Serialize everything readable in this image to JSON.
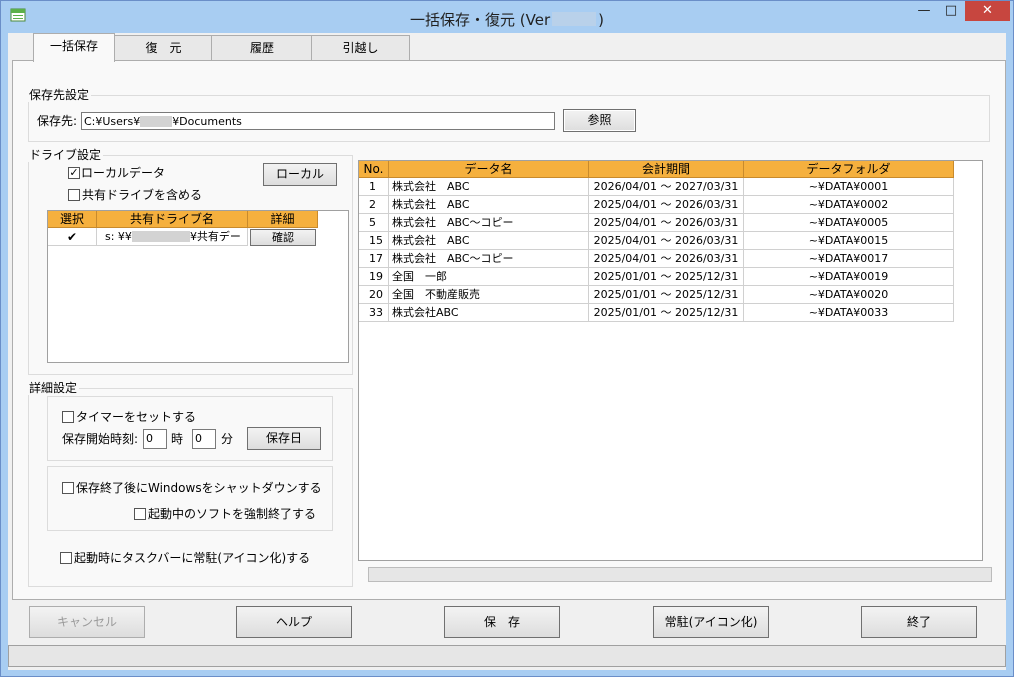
{
  "window": {
    "title_prefix": "一括保存・復元 (Ver",
    "title_suffix": ")",
    "min_glyph": "—",
    "max_glyph": "□",
    "close_glyph": "✕"
  },
  "tabs": [
    {
      "label": "一括保存",
      "active": true
    },
    {
      "label": "復　元"
    },
    {
      "label": "履歴"
    },
    {
      "label": "引越し"
    }
  ],
  "save_dest": {
    "group_title": "保存先設定",
    "label": "保存先:",
    "path_prefix": "C:¥Users¥",
    "path_suffix": "¥Documents",
    "browse_label": "参照"
  },
  "drive": {
    "group_title": "ドライブ設定",
    "local_data_label": "ローカルデータ",
    "local_data_checked": true,
    "include_shared_label": "共有ドライブを含める",
    "include_shared_checked": false,
    "local_button": "ローカル",
    "grid_headers": [
      "選択",
      "共有ドライブ名",
      "詳細"
    ],
    "grid_rows": [
      {
        "selected": true,
        "name_prefix": "s: ¥¥",
        "name_suffix": "¥共有デー",
        "detail": "確認"
      }
    ]
  },
  "detail": {
    "group_title": "詳細設定",
    "timer_label": "タイマーをセットする",
    "timer_checked": false,
    "start_time_label": "保存開始時刻:",
    "hour_value": "0",
    "hour_unit": "時",
    "minute_value": "0",
    "minute_unit": "分",
    "save_day_button": "保存日",
    "shutdown_label": "保存終了後にWindowsをシャットダウンする",
    "force_quit_label": "起動中のソフトを強制終了する",
    "tray_label": "起動時にタスクバーに常駐(アイコン化)する"
  },
  "data_table": {
    "headers": [
      "No.",
      "データ名",
      "会計期間",
      "データフォルダ"
    ],
    "rows": [
      [
        "1",
        "株式会社　ABC",
        "2026/04/01 ～ 2027/03/31",
        "~¥DATA¥0001"
      ],
      [
        "2",
        "株式会社　ABC",
        "2025/04/01 ～ 2026/03/31",
        "~¥DATA¥0002"
      ],
      [
        "5",
        "株式会社　ABC～コピー",
        "2025/04/01 ～ 2026/03/31",
        "~¥DATA¥0005"
      ],
      [
        "15",
        "株式会社　ABC",
        "2025/04/01 ～ 2026/03/31",
        "~¥DATA¥0015"
      ],
      [
        "17",
        "株式会社　ABC～コピー",
        "2025/04/01 ～ 2026/03/31",
        "~¥DATA¥0017"
      ],
      [
        "19",
        "全国　一郎",
        "2025/01/01 ～ 2025/12/31",
        "~¥DATA¥0019"
      ],
      [
        "20",
        "全国　不動産販売",
        "2025/01/01 ～ 2025/12/31",
        "~¥DATA¥0020"
      ],
      [
        "33",
        "株式会社ABC",
        "2025/01/01 ～ 2025/12/31",
        "~¥DATA¥0033"
      ]
    ]
  },
  "progress": 0,
  "buttons": {
    "cancel": "キャンセル",
    "help": "ヘルプ",
    "save": "保　存",
    "resident": "常駐(アイコン化)",
    "exit": "終了"
  },
  "colors": {
    "title_bar": "#a8cdf2",
    "grid_header": "#f5b03e",
    "close_button": "#c7463f"
  }
}
